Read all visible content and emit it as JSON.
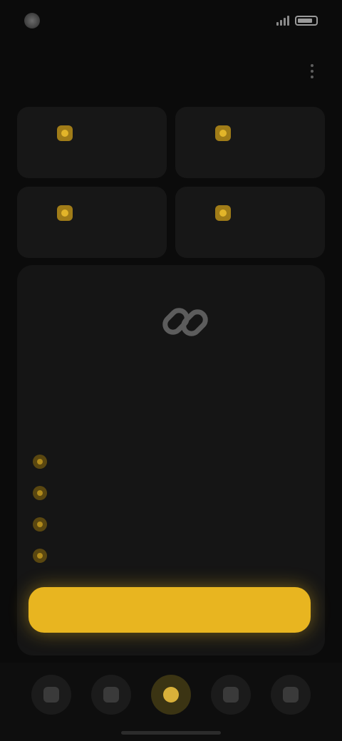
{
  "status_bar": {
    "time": "",
    "left_caption": "",
    "right_caption": ""
  },
  "header": {
    "title": "",
    "subtitle": ""
  },
  "tiles": [
    {
      "caption": "",
      "label": ""
    },
    {
      "caption": "",
      "label": ""
    },
    {
      "caption": "",
      "label": ""
    },
    {
      "caption": "",
      "label": ""
    }
  ],
  "card": {
    "title": "",
    "description": "",
    "features": [
      "",
      "",
      "",
      ""
    ]
  },
  "cta": {
    "label": ""
  },
  "tabbar": {
    "tabs": [
      {
        "icon": "home-icon",
        "active": false
      },
      {
        "icon": "grid-icon",
        "active": false
      },
      {
        "icon": "star-icon",
        "active": true
      },
      {
        "icon": "list-icon",
        "active": false
      },
      {
        "icon": "profile-icon",
        "active": false
      }
    ]
  },
  "colors": {
    "accent": "#e8b520",
    "background": "#0b0b0b",
    "card": "#151515"
  }
}
